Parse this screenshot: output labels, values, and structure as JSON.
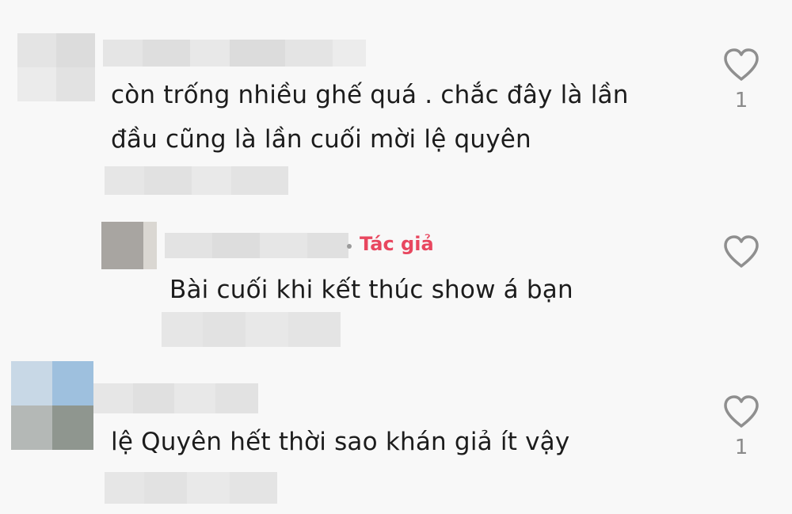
{
  "comments": [
    {
      "text_lines": [
        "còn trống nhiều ghế quá . chắc đây là lần",
        "đầu cũng là lần cuối mời lệ quyên"
      ],
      "like_count": "1"
    },
    {
      "text_lines": [
        "Bài cuối khi kết thúc show á bạn"
      ],
      "author_tag": "Tác giả",
      "like_count": ""
    },
    {
      "text_lines": [
        "lệ Quyên hết thời sao khán giả ít vậy"
      ],
      "like_count": "1"
    }
  ],
  "icons": {
    "like": "heart-outline-icon"
  },
  "colors": {
    "author_tag": "#e8475f",
    "like_icon": "#8f8f8f",
    "background": "#f8f8f8"
  }
}
